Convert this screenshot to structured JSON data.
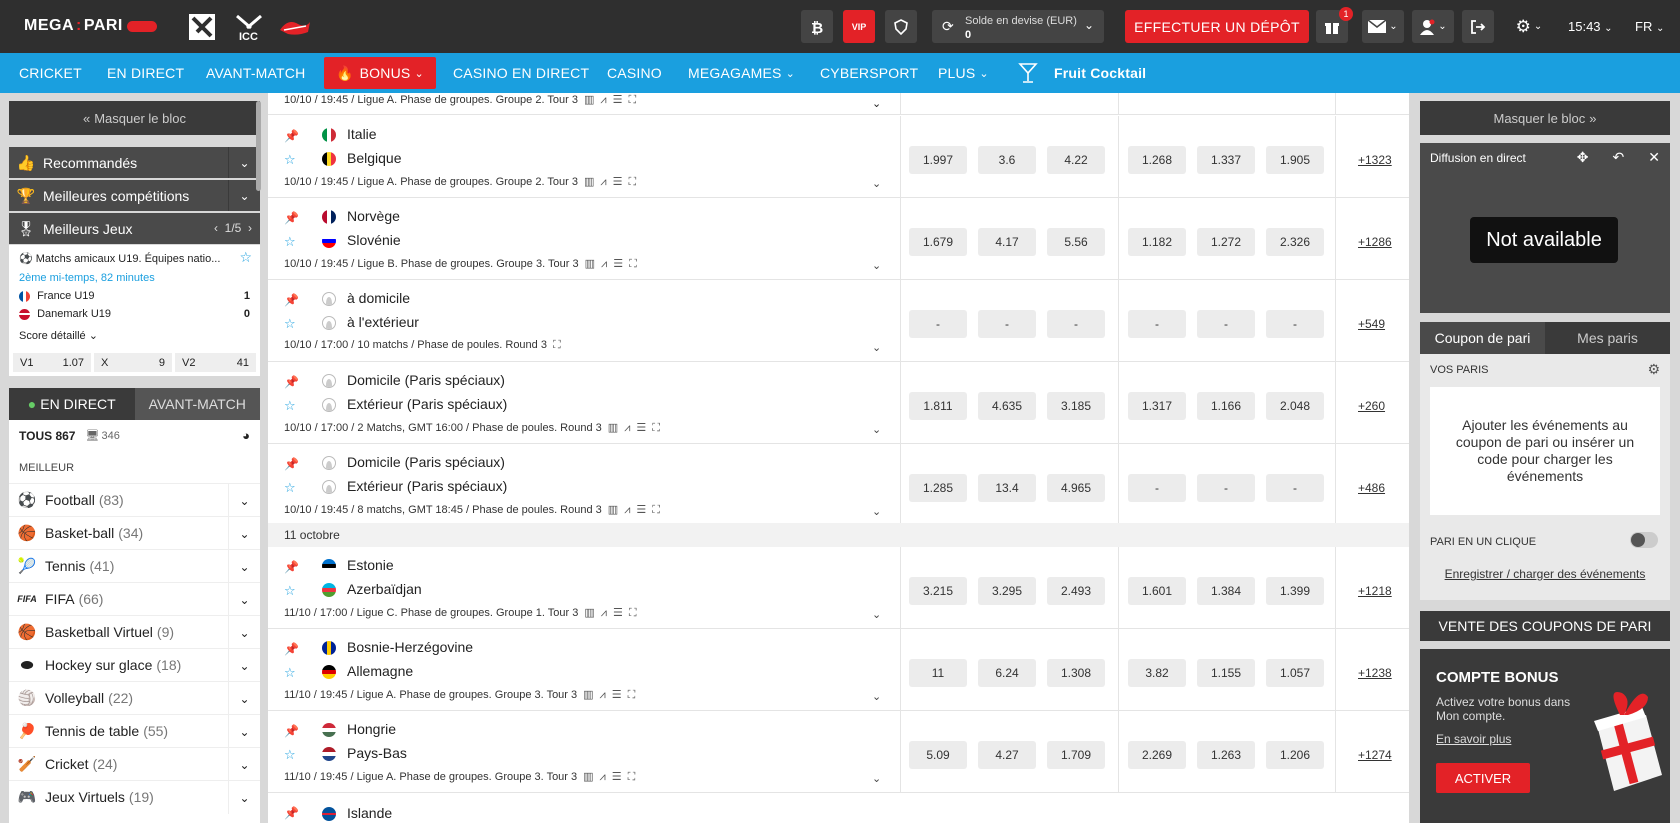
{
  "header": {
    "logo": "MEGA",
    "logo_suffix": "PARI",
    "partners": [
      "DOTA 2",
      "ICC",
      "ROO"
    ],
    "vip": "VIP",
    "balance_label": "Solde en devise (EUR)",
    "balance_value": "0",
    "deposit": "EFFECTUER UN DÉPÔT",
    "gift_count": "1",
    "time": "15:43",
    "lang": "FR"
  },
  "nav": {
    "items": [
      "CRICKET",
      "EN DIRECT",
      "AVANT-MATCH",
      "BONUS",
      "CASINO EN DIRECT",
      "CASINO",
      "MEGAGAMES",
      "CYBERSPORT",
      "PLUS",
      "Fruit Cocktail"
    ]
  },
  "left": {
    "hide": "Masquer le bloc",
    "recommended": "Recommandés",
    "best_comps": "Meilleures compétitions",
    "best_games": "Meilleurs Jeux",
    "pager": "1/5",
    "game": {
      "league": "Matchs amicaux U19. Équipes natio...",
      "status": "2ème mi-temps, 82 minutes",
      "team1": "France U19",
      "score1": "1",
      "team2": "Danemark U19",
      "score2": "0",
      "detail": "Score détaillé",
      "odds": [
        {
          "k": "V1",
          "v": "1.07"
        },
        {
          "k": "X",
          "v": "9"
        },
        {
          "k": "V2",
          "v": "41"
        }
      ]
    },
    "tab_live": "EN DIRECT",
    "tab_pre": "AVANT-MATCH",
    "all": "TOUS 867",
    "all_video": "346",
    "best": "MEILLEUR",
    "sports": [
      {
        "name": "Football",
        "count": "(83)"
      },
      {
        "name": "Basket-ball",
        "count": "(34)"
      },
      {
        "name": "Tennis",
        "count": "(41)"
      },
      {
        "name": "FIFA",
        "count": "(66)"
      },
      {
        "name": "Basketball Virtuel",
        "count": "(9)"
      },
      {
        "name": "Hockey sur glace",
        "count": "(18)"
      },
      {
        "name": "Volleyball",
        "count": "(22)"
      },
      {
        "name": "Tennis de table",
        "count": "(55)"
      },
      {
        "name": "Cricket",
        "count": "(24)"
      },
      {
        "name": "Jeux Virtuels",
        "count": "(19)"
      }
    ]
  },
  "events": {
    "top_partial_meta": "10/10 / 19:45 / Ligue A. Phase de groupes. Groupe 2. Tour 3",
    "date_band": "11 octobre",
    "bottom_partial_team": "Islande",
    "rows": [
      {
        "t1": "Italie",
        "t2": "Belgique",
        "meta": "10/10 / 19:45 / Ligue A. Phase de groupes. Groupe 2. Tour 3",
        "odds": [
          "1.997",
          "3.6",
          "4.22",
          "1.268",
          "1.337",
          "1.905"
        ],
        "more": "+1323"
      },
      {
        "t1": "Norvège",
        "t2": "Slovénie",
        "meta": "10/10 / 19:45 / Ligue B. Phase de groupes. Groupe 3. Tour 3",
        "odds": [
          "1.679",
          "4.17",
          "5.56",
          "1.182",
          "1.272",
          "2.326"
        ],
        "more": "+1286"
      },
      {
        "t1": "à domicile",
        "t2": "à l'extérieur",
        "meta": "10/10 / 17:00 / 10 matchs / Phase de poules. Round 3",
        "odds": [
          "-",
          "-",
          "-",
          "-",
          "-",
          "-"
        ],
        "more": "+549"
      },
      {
        "t1": "Domicile (Paris spéciaux)",
        "t2": "Extérieur (Paris spéciaux)",
        "meta": "10/10 / 17:00 / 2 Matchs, GMT 16:00 / Phase de poules. Round 3",
        "odds": [
          "1.811",
          "4.635",
          "3.185",
          "1.317",
          "1.166",
          "2.048"
        ],
        "more": "+260"
      },
      {
        "t1": "Domicile (Paris spéciaux)",
        "t2": "Extérieur (Paris spéciaux)",
        "meta": "10/10 / 19:45 / 8 matchs, GMT 18:45 / Phase de poules. Round 3",
        "odds": [
          "1.285",
          "13.4",
          "4.965",
          "-",
          "-",
          "-"
        ],
        "more": "+486"
      },
      {
        "t1": "Estonie",
        "t2": "Azerbaïdjan",
        "meta": "11/10 / 17:00 / Ligue C. Phase de groupes. Groupe 1. Tour 3",
        "odds": [
          "3.215",
          "3.295",
          "2.493",
          "1.601",
          "1.384",
          "1.399"
        ],
        "more": "+1218"
      },
      {
        "t1": "Bosnie-Herzégovine",
        "t2": "Allemagne",
        "meta": "11/10 / 19:45 / Ligue A. Phase de groupes. Groupe 3. Tour 3",
        "odds": [
          "11",
          "6.24",
          "1.308",
          "3.82",
          "1.155",
          "1.057"
        ],
        "more": "+1238"
      },
      {
        "t1": "Hongrie",
        "t2": "Pays-Bas",
        "meta": "11/10 / 19:45 / Ligue A. Phase de groupes. Groupe 3. Tour 3",
        "odds": [
          "5.09",
          "4.27",
          "1.709",
          "2.269",
          "1.263",
          "1.206"
        ],
        "more": "+1274"
      }
    ]
  },
  "right": {
    "hide": "Masquer le bloc",
    "stream_title": "Diffusion en direct",
    "not_available": "Not available",
    "tab_coupon": "Coupon de pari",
    "tab_mybets": "Mes paris",
    "your_bets": "VOS PARIS",
    "empty": "Ajouter les événements au coupon de pari ou insérer un code pour charger les événements",
    "one_click": "PARI EN UN CLIQUE",
    "save_load": "Enregistrer / charger des événements",
    "sale": "VENTE DES COUPONS DE PARI",
    "bonus_title": "COMPTE BONUS",
    "bonus_desc": "Activez votre bonus dans Mon compte.",
    "learn_more": "En savoir plus",
    "activate": "ACTIVER"
  },
  "colors": {
    "brand_red": "#e32227",
    "nav_blue": "#1a9fdf",
    "header_dark": "#2f2f2f"
  }
}
